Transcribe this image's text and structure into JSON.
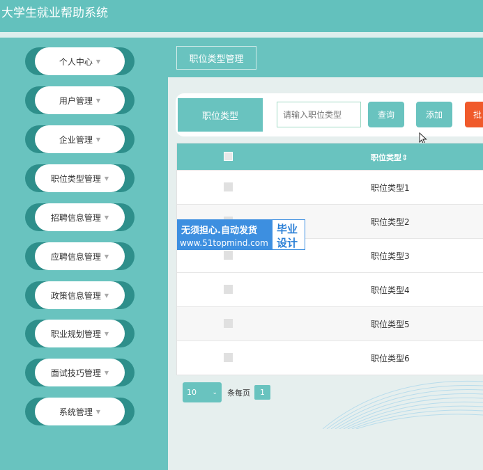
{
  "app": {
    "title": "大学生就业帮助系统"
  },
  "sidebar": {
    "items": [
      {
        "label": "个人中心"
      },
      {
        "label": "用户管理"
      },
      {
        "label": "企业管理"
      },
      {
        "label": "职位类型管理"
      },
      {
        "label": "招聘信息管理"
      },
      {
        "label": "应聘信息管理"
      },
      {
        "label": "政策信息管理"
      },
      {
        "label": "职业规划管理"
      },
      {
        "label": "面试技巧管理"
      },
      {
        "label": "系统管理"
      }
    ]
  },
  "tabs": {
    "active": "职位类型管理"
  },
  "search": {
    "label": "职位类型",
    "placeholder": "请输入职位类型",
    "query_button": "查询",
    "add_button": "添加",
    "batch_button": "批"
  },
  "table": {
    "header": "职位类型",
    "sort_indicator": "⇕",
    "rows": [
      "职位类型1",
      "职位类型2",
      "职位类型3",
      "职位类型4",
      "职位类型5",
      "职位类型6"
    ]
  },
  "pagination": {
    "page_size": "10",
    "per_page_label": "条每页",
    "current_page": "1"
  },
  "watermark": {
    "line1": "无须担心.自动发货",
    "line2": "www.51topmind.com",
    "right1": "毕业",
    "right2": "设计"
  },
  "colors": {
    "accent": "#69c3bf",
    "accent_dark": "#2e8f8b",
    "danger": "#f05a2b"
  }
}
